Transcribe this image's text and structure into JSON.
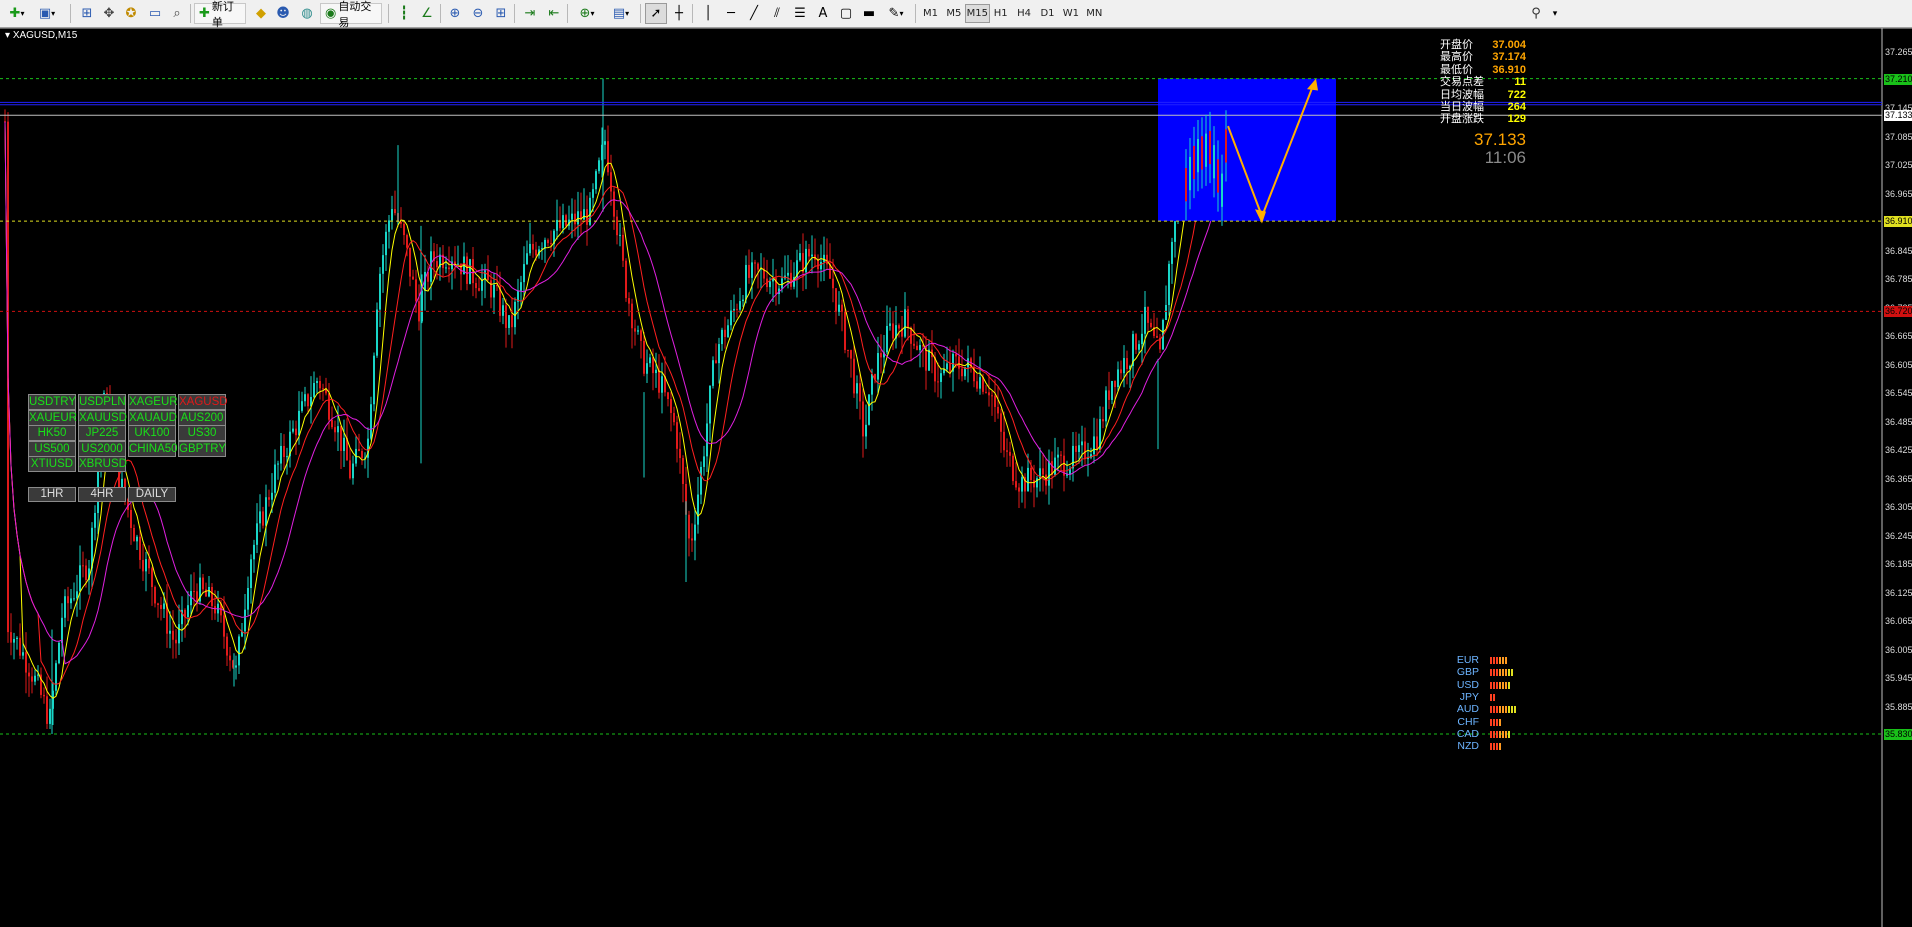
{
  "toolbar": {
    "new_order_label": "新订单",
    "auto_trade_label": "自动交易",
    "timeframes": [
      "M1",
      "M5",
      "M15",
      "H1",
      "H4",
      "D1",
      "W1",
      "MN"
    ],
    "active_timeframe": "M15"
  },
  "chart": {
    "title": "XAGUSD,M15",
    "price_axis": [
      "37.265",
      "37.205",
      "37.145",
      "37.085",
      "37.025",
      "36.965",
      "36.905",
      "36.845",
      "36.785",
      "36.725",
      "36.665",
      "36.605",
      "36.545",
      "36.485",
      "36.425",
      "36.365",
      "36.305",
      "36.245",
      "36.185",
      "36.125",
      "36.065",
      "36.005",
      "35.945",
      "35.885",
      "35.825"
    ],
    "price_tags": {
      "high_line": "37.210",
      "current": "37.133",
      "low_line": "36.910",
      "red_line": "36.720",
      "bottom_line": "35.830"
    },
    "colors": {
      "bull": "#19d6c8",
      "bear": "#e01a1a",
      "ma_fast": "#ffff00",
      "ma_mid": "#ff2020",
      "ma_slow": "#e020e0",
      "box": "#0000ff",
      "arrow": "#ffae00"
    }
  },
  "info_panel": {
    "rows": [
      {
        "label": "开盘价",
        "value": "37.004",
        "color": "#ffa500"
      },
      {
        "label": "最高价",
        "value": "37.174",
        "color": "#ffa500"
      },
      {
        "label": "最低价",
        "value": "36.910",
        "color": "#ffa500"
      },
      {
        "label": "交易点差",
        "value": "11",
        "color": "#ffff00"
      },
      {
        "label": "日均波幅",
        "value": "722",
        "color": "#ffff00"
      },
      {
        "label": "当日波幅",
        "value": "264",
        "color": "#ffff00"
      },
      {
        "label": "开盘涨跌",
        "value": "129",
        "color": "#ffff00"
      }
    ],
    "current_price": "37.133",
    "timer": "11:06"
  },
  "symbol_panel": {
    "symbols": [
      {
        "label": "USDTRY",
        "active": false
      },
      {
        "label": "USDPLN",
        "active": false
      },
      {
        "label": "XAGEUR",
        "active": false
      },
      {
        "label": "XAGUSD",
        "active": true
      },
      {
        "label": "XAUEUR",
        "active": false
      },
      {
        "label": "XAUUSD",
        "active": false
      },
      {
        "label": "XAUAUD",
        "active": false
      },
      {
        "label": "AUS200",
        "active": false
      },
      {
        "label": "HK50",
        "active": false
      },
      {
        "label": "JP225",
        "active": false
      },
      {
        "label": "UK100",
        "active": false
      },
      {
        "label": "US30",
        "active": false
      },
      {
        "label": "US500",
        "active": false
      },
      {
        "label": "US2000",
        "active": false
      },
      {
        "label": "CHINA50",
        "active": false
      },
      {
        "label": "GBPTRY",
        "active": false
      },
      {
        "label": "XTIUSD",
        "active": false
      },
      {
        "label": "XBRUSD",
        "active": false
      }
    ],
    "timeframes": [
      "1HR",
      "4HR",
      "DAILY"
    ]
  },
  "currency_strength": [
    {
      "name": "EUR",
      "bars": 6
    },
    {
      "name": "GBP",
      "bars": 8
    },
    {
      "name": "USD",
      "bars": 7
    },
    {
      "name": "JPY",
      "bars": 2
    },
    {
      "name": "AUD",
      "bars": 9
    },
    {
      "name": "CHF",
      "bars": 4
    },
    {
      "name": "CAD",
      "bars": 7
    },
    {
      "name": "NZD",
      "bars": 4
    }
  ]
}
